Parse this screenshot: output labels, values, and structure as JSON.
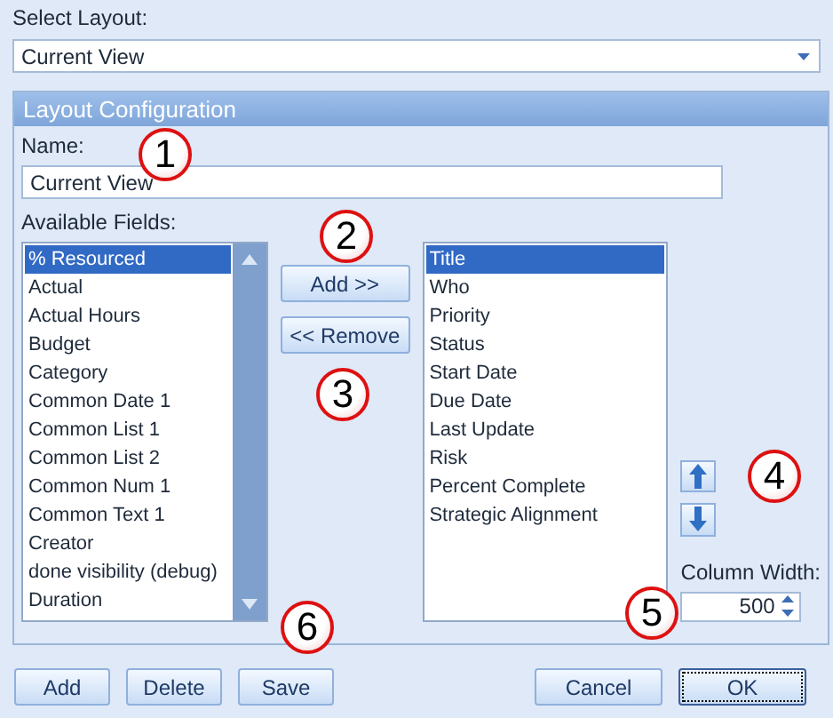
{
  "select_layout": {
    "label": "Select Layout:",
    "value": "Current View"
  },
  "panel": {
    "title": "Layout Configuration",
    "name": {
      "label": "Name:",
      "value": "Current View"
    },
    "available_fields": {
      "label": "Available Fields:",
      "items": [
        {
          "label": "% Resourced",
          "selected": true
        },
        {
          "label": "Actual",
          "selected": false
        },
        {
          "label": "Actual Hours",
          "selected": false
        },
        {
          "label": "Budget",
          "selected": false
        },
        {
          "label": "Category",
          "selected": false
        },
        {
          "label": "Common Date 1",
          "selected": false
        },
        {
          "label": "Common List 1",
          "selected": false
        },
        {
          "label": "Common List 2",
          "selected": false
        },
        {
          "label": "Common Num 1",
          "selected": false
        },
        {
          "label": "Common Text 1",
          "selected": false
        },
        {
          "label": "Creator",
          "selected": false
        },
        {
          "label": "done visibility (debug)",
          "selected": false
        },
        {
          "label": "Duration",
          "selected": false
        }
      ]
    },
    "add_button": "Add >>",
    "remove_button": "<< Remove",
    "selected_fields": [
      {
        "label": "Title",
        "selected": true
      },
      {
        "label": "Who",
        "selected": false
      },
      {
        "label": "Priority",
        "selected": false
      },
      {
        "label": "Status",
        "selected": false
      },
      {
        "label": "Start Date",
        "selected": false
      },
      {
        "label": "Due Date",
        "selected": false
      },
      {
        "label": "Last Update",
        "selected": false
      },
      {
        "label": "Risk",
        "selected": false
      },
      {
        "label": "Percent Complete",
        "selected": false
      },
      {
        "label": "Strategic Alignment",
        "selected": false
      }
    ],
    "column_width": {
      "label": "Column Width:",
      "value": "500"
    }
  },
  "footer_buttons": [
    {
      "label": "Add",
      "focused": false
    },
    {
      "label": "Delete",
      "focused": false
    },
    {
      "label": "Save",
      "focused": false
    },
    {
      "label": "Cancel",
      "focused": false
    },
    {
      "label": "OK",
      "focused": true
    }
  ],
  "callouts": [
    "1",
    "2",
    "3",
    "4",
    "5",
    "6"
  ]
}
